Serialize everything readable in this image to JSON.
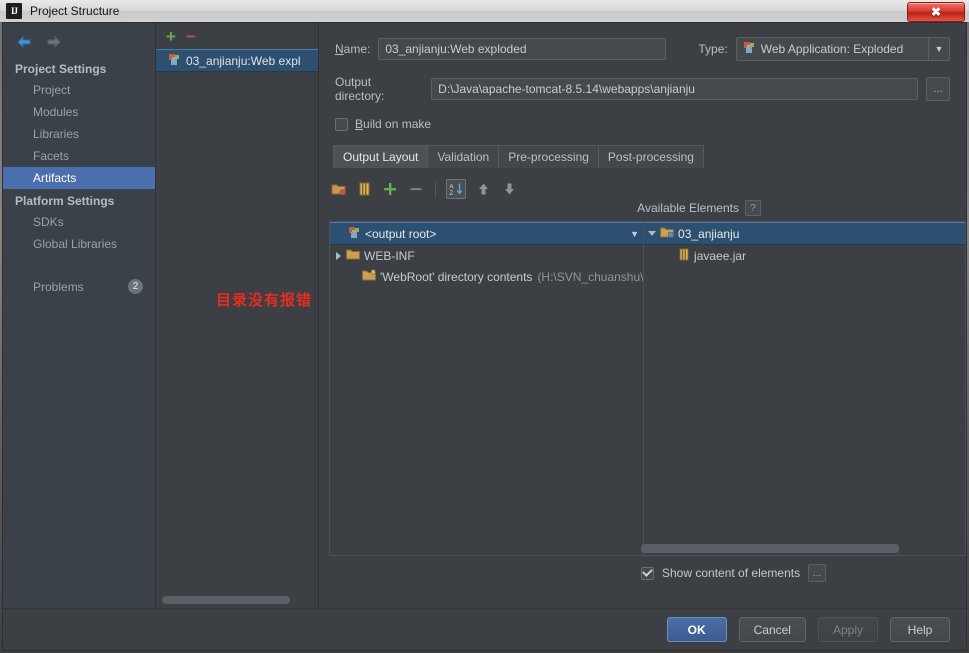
{
  "window": {
    "title": "Project Structure",
    "logo": "intellij-logo-icon",
    "close_label": "✖"
  },
  "sidebar": {
    "back_icon": "arrow-left-icon",
    "forward_icon": "arrow-right-icon",
    "groups": [
      {
        "title": "Project Settings",
        "items": [
          {
            "label": "Project",
            "selected": false
          },
          {
            "label": "Modules",
            "selected": false
          },
          {
            "label": "Libraries",
            "selected": false
          },
          {
            "label": "Facets",
            "selected": false
          },
          {
            "label": "Artifacts",
            "selected": true
          }
        ]
      },
      {
        "title": "Platform Settings",
        "items": [
          {
            "label": "SDKs",
            "selected": false
          },
          {
            "label": "Global Libraries",
            "selected": false
          }
        ]
      }
    ],
    "problems": {
      "label": "Problems",
      "count": "2"
    }
  },
  "artifacts_list": {
    "add_label": "+",
    "remove_label": "−",
    "items": [
      {
        "label": "03_anjianju:Web expl",
        "selected": true
      }
    ]
  },
  "form": {
    "name_label": "Name:",
    "name_value": "03_anjianju:Web exploded",
    "type_label": "Type:",
    "type_value": "Web Application: Exploded",
    "output_label": "Output directory:",
    "output_value": "D:\\Java\\apache-tomcat-8.5.14\\webapps\\anjianju",
    "output_browse_label": "...",
    "build_on_make_label": "Build on make",
    "build_on_make_checked": false
  },
  "tabs": [
    {
      "label": "Output Layout",
      "active": true
    },
    {
      "label": "Validation",
      "active": false
    },
    {
      "label": "Pre-processing",
      "active": false
    },
    {
      "label": "Post-processing",
      "active": false
    }
  ],
  "layout_toolbar": {
    "buttons": [
      {
        "name": "create-directory-icon",
        "label": ""
      },
      {
        "name": "create-archive-icon",
        "label": ""
      },
      {
        "name": "add-icon",
        "label": "+"
      },
      {
        "name": "remove-icon",
        "label": "−"
      },
      {
        "name": "sort-alphabetically-icon",
        "label": ""
      },
      {
        "name": "move-up-icon",
        "label": ""
      },
      {
        "name": "move-down-icon",
        "label": ""
      }
    ]
  },
  "available_elements": {
    "header": "Available Elements",
    "help_label": "?"
  },
  "output_tree": {
    "rows": [
      {
        "indent": 0,
        "twisty": "none",
        "icon": "artifact-icon",
        "label": "<output root>",
        "dim": "",
        "selected": true
      },
      {
        "indent": 0,
        "twisty": "collapsed",
        "icon": "folder-icon",
        "label": "WEB-INF",
        "dim": "",
        "selected": false
      },
      {
        "indent": 1,
        "twisty": "none",
        "icon": "directory-contents-icon",
        "label": "'WebRoot' directory contents",
        "dim": "(H:\\SVN_chuanshu\\",
        "selected": false
      }
    ]
  },
  "available_tree": {
    "rows": [
      {
        "indent": 0,
        "twisty": "expanded",
        "icon": "module-icon",
        "label": "03_anjianju",
        "selected": true
      },
      {
        "indent": 1,
        "twisty": "none",
        "icon": "jar-icon",
        "label": "javaee.jar",
        "selected": false
      }
    ]
  },
  "show_content": {
    "label": "Show content of elements",
    "checked": true,
    "ellipsis_label": "..."
  },
  "annotation": {
    "text": "目录没有报错",
    "color": "#d6332a"
  },
  "footer": {
    "ok": "OK",
    "cancel": "Cancel",
    "apply": "Apply",
    "help": "Help"
  },
  "colors": {
    "background": "#3c4044",
    "selection": "#2d4f70",
    "nav_selection": "#4b6eaf",
    "accent_green": "#6aab4e",
    "accent_red": "#b05a4e",
    "annotation_red": "#d6332a"
  }
}
